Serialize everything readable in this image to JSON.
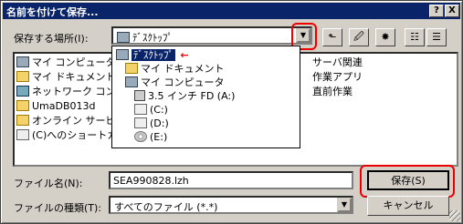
{
  "window": {
    "title": "名前を付けて保存...",
    "help_btn": "?",
    "close_btn": "X"
  },
  "save_in": {
    "label": "保存する場所(I):",
    "value": "ﾃﾞｽｸﾄｯﾌﾟ"
  },
  "toolbar": {
    "up_icon": "folder-up-icon",
    "desktop_icon": "desktop-icon",
    "new_folder_icon": "new-folder-icon",
    "list_icon": "list-view-icon",
    "details_icon": "details-view-icon"
  },
  "file_list": {
    "left": [
      {
        "label": "マイ コンピュータ",
        "icon": "my-computer-icon"
      },
      {
        "label": "マイ ドキュメント",
        "icon": "my-documents-icon"
      },
      {
        "label": "ネットワーク コンピュータ",
        "icon": "network-icon"
      },
      {
        "label": "UmaDB013d",
        "icon": "folder-icon"
      },
      {
        "label": "オンライン サービス",
        "icon": "folder-icon"
      },
      {
        "label": "(C)へのショートカ",
        "icon": "shortcut-icon"
      }
    ],
    "right": [
      {
        "label": "サーバ関連",
        "icon": "folder-icon"
      },
      {
        "label": "作業アプリ",
        "icon": "folder-icon"
      },
      {
        "label": "直前作業",
        "icon": "folder-icon"
      }
    ]
  },
  "dropdown": [
    {
      "label": "ﾃﾞｽｸﾄｯﾌﾟ",
      "icon": "desktop-icon",
      "selected": true
    },
    {
      "label": "マイ ドキュメント",
      "icon": "my-documents-icon"
    },
    {
      "label": "マイ コンピュータ",
      "icon": "my-computer-icon"
    },
    {
      "label": "3.5 インチ FD (A:)",
      "icon": "floppy-icon"
    },
    {
      "label": "(C:)",
      "icon": "drive-icon"
    },
    {
      "label": "(D:)",
      "icon": "drive-icon"
    },
    {
      "label": "(E:)",
      "icon": "cd-drive-icon"
    }
  ],
  "filename": {
    "label": "ファイル名(N):",
    "value": "SEA990828.lzh"
  },
  "filetype": {
    "label": "ファイルの種類(T):",
    "value": "すべてのファイル (*.*)"
  },
  "buttons": {
    "save": "保存(S)",
    "cancel": "キャンセル"
  },
  "colors": {
    "title_bar": "#0a246a",
    "selection": "#0a246a",
    "highlight_red": "#e00000"
  }
}
